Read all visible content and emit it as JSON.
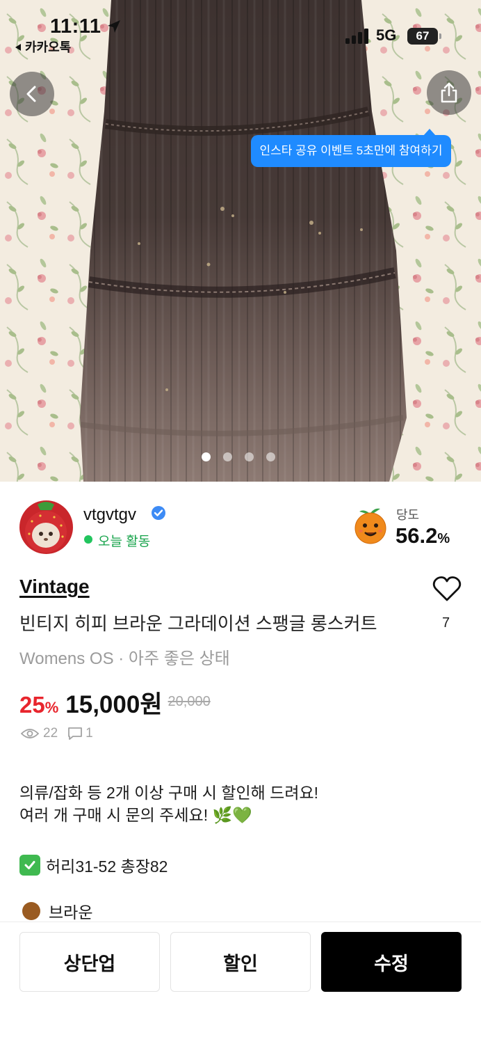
{
  "status_bar": {
    "time": "11:11",
    "back_app": "카카오톡",
    "network": "5G",
    "battery": "67"
  },
  "hero": {
    "tooltip": "인스타 공유 이벤트 5초만에 참여하기",
    "page_count": 4,
    "active_page": 1
  },
  "seller": {
    "name": "vtgvtgv",
    "activity": "오늘 활동",
    "temperature_label": "당도",
    "temperature_value": "56.2",
    "temperature_unit": "%"
  },
  "product": {
    "brand": "Vintage",
    "title": "빈티지 히피 브라운 그라데이션 스팽글 롱스커트",
    "meta": "Womens OS · 아주 좋은 상태",
    "like_count": "7",
    "discount": "25",
    "discount_unit": "%",
    "price": "15,000원",
    "original_price": "20,000",
    "views": "22",
    "chats": "1"
  },
  "description": {
    "line1": "의류/잡화 등 2개 이상 구매 시 할인해 드려요!",
    "line2": "여러 개 구매 시 문의 주세요! 🌿💚",
    "line3": "허리31-52 총장82",
    "line4": "브라운"
  },
  "actions": {
    "bump": "상단업",
    "discount": "할인",
    "edit": "수정"
  },
  "colors": {
    "accent_blue": "#1f8bff",
    "discount_red": "#e8252d",
    "active_green": "#22c55e"
  }
}
